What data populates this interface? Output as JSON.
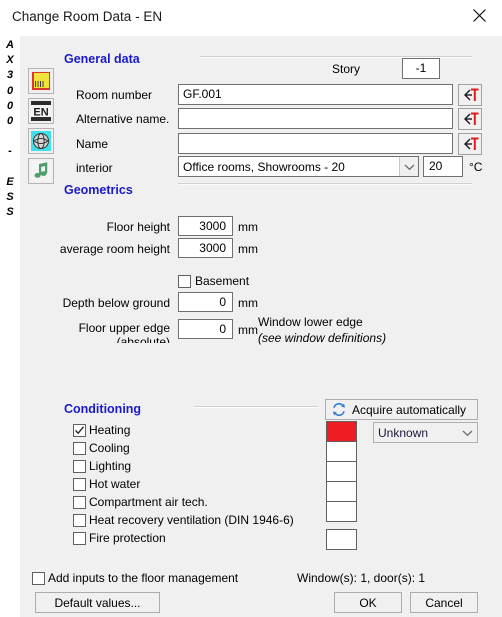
{
  "window": {
    "title": "Change Room Data - EN",
    "close_icon": "close-icon",
    "rail_text": [
      "A",
      "X",
      "3",
      "0",
      "0",
      "0",
      "",
      "-",
      "",
      "E",
      "S",
      "S"
    ],
    "icons": [
      {
        "name": "room-area-icon"
      },
      {
        "name": "en-language-icon"
      },
      {
        "name": "globe-icon"
      },
      {
        "name": "music-note-icon"
      }
    ]
  },
  "general": {
    "section_title": "General data",
    "story_label": "Story",
    "story_value": "-1",
    "room_number_label": "Room number",
    "room_number_value": "GF.001",
    "alt_name_label": "Alternative name.",
    "alt_name_value": "",
    "name_label": "Name",
    "name_value": "",
    "interior_label": "interior",
    "interior_value": "Office rooms, Showrooms - 20",
    "temperature_value": "20",
    "temperature_unit": "°C",
    "pick_button_icon": "pick-text-icon"
  },
  "geometrics": {
    "section_title": "Geometrics",
    "floor_height_label": "Floor height",
    "floor_height_value": "3000",
    "floor_height_unit": "mm",
    "avg_room_height_label": "average room height",
    "avg_room_height_value": "3000",
    "avg_room_height_unit": "mm",
    "basement_label": "Basement",
    "basement_checked": false,
    "depth_label": "Depth below ground",
    "depth_value": "0",
    "depth_unit": "mm",
    "floor_upper_edge_label_line1": "Floor upper edge",
    "floor_upper_edge_label_line2": "(absolute)",
    "floor_upper_edge_value": "0",
    "floor_upper_edge_unit": "mm",
    "window_lower_edge_title": "Window lower edge",
    "window_lower_edge_note": "(see window definitions)"
  },
  "conditioning": {
    "section_title": "Conditioning",
    "acquire_button_label": "Acquire automatically",
    "acquire_icon": "refresh-icon",
    "status_dropdown_value": "Unknown",
    "items": [
      {
        "label": "Heating",
        "checked": true,
        "color": "#ee1c23",
        "has_swatch": true
      },
      {
        "label": "Cooling",
        "checked": false,
        "color": "#ffffff",
        "has_swatch": true
      },
      {
        "label": "Lighting",
        "checked": false,
        "color": "#ffffff",
        "has_swatch": true
      },
      {
        "label": "Hot water",
        "checked": false,
        "color": "#ffffff",
        "has_swatch": true
      },
      {
        "label": "Compartment air tech.",
        "checked": false,
        "color": "#ffffff",
        "has_swatch": true
      },
      {
        "label": "Heat recovery ventilation (DIN 1946-6)",
        "checked": false,
        "color": null,
        "has_swatch": false
      },
      {
        "label": "Fire protection",
        "checked": false,
        "color": "#ffffff",
        "has_swatch": true
      }
    ]
  },
  "footer": {
    "add_inputs_label": "Add inputs to the floor management",
    "add_inputs_checked": false,
    "counts_label": "Window(s): 1, door(s): 1",
    "default_values_label": "Default values...",
    "ok_label": "OK",
    "cancel_label": "Cancel"
  },
  "colors": {
    "accent_heading": "#1a1aca",
    "dialog_bg": "#f0f0f0",
    "heating_red": "#ee1c23"
  }
}
